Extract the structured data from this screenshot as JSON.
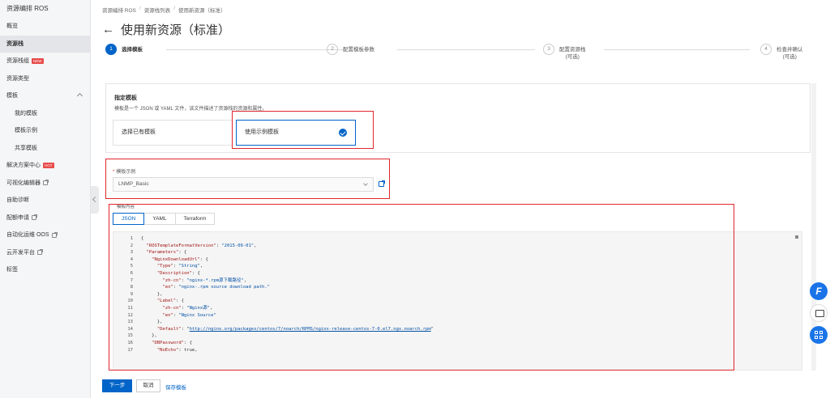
{
  "sidebar": {
    "title": "资源编排 ROS",
    "items": [
      {
        "label": "概览"
      },
      {
        "label": "资源栈",
        "active": true
      },
      {
        "label": "资源栈组",
        "badge": "NEW"
      },
      {
        "label": "资源类型"
      },
      {
        "label": "模板",
        "expandable": true
      },
      {
        "label": "我的模板",
        "sub": true
      },
      {
        "label": "模板示例",
        "sub": true
      },
      {
        "label": "共享模板",
        "sub": true
      },
      {
        "label": "解决方案中心",
        "badge": "HOT"
      },
      {
        "label": "可视化编辑器",
        "external": true
      },
      {
        "label": "自助诊断"
      },
      {
        "label": "配额申请",
        "external": true
      },
      {
        "label": "自动化运维 OOS",
        "external": true
      },
      {
        "label": "云开发平台",
        "external": true
      },
      {
        "label": "标签"
      }
    ]
  },
  "breadcrumb": [
    "资源编排 ROS",
    "资源栈列表",
    "使用新资源（标准）"
  ],
  "page_title": "使用新资源（标准）",
  "steps": [
    {
      "num": "1",
      "label": "选择模板",
      "active": true
    },
    {
      "num": "2",
      "label": "配置模板参数"
    },
    {
      "num": "3",
      "label": "配置资源栈",
      "sub": "(可选)"
    },
    {
      "num": "4",
      "label": "检查并确认",
      "sub": "(可选)"
    }
  ],
  "specify_template": {
    "title": "指定模板",
    "description": "模板是一个 JSON 或 YAML 文件，该文件描述了资源栈的资源和属性。",
    "options": [
      "选择已有模板",
      "使用示例模板"
    ],
    "selected": "使用示例模板"
  },
  "template_example": {
    "label": "模板示例",
    "value": "LNMP_Basic"
  },
  "template_content": {
    "label": "模板内容",
    "tabs": [
      "JSON",
      "YAML",
      "Terraform"
    ],
    "active_tab": "JSON"
  },
  "code_lines": [
    "{",
    "  \"ROSTemplateFormatVersion\": \"2015-09-01\",",
    "  \"Parameters\": {",
    "    \"NginxDownloadUrl\": {",
    "      \"Type\": \"String\",",
    "      \"Description\": {",
    "        \"zh-cn\": \"nginx-*.rpm源下载路径\",",
    "        \"en\": \"nginx-.rpm source download path.\"",
    "      },",
    "      \"Label\": {",
    "        \"zh-cn\": \"Nginx源\",",
    "        \"en\": \"Nginx Source\"",
    "      },",
    "      \"Default\": \"http://nginx.org/packages/centos/7/noarch/RPMS/nginx-release-centos-7-0.el7.ngx.noarch.rpm\"",
    "    },",
    "    \"DBPassword\": {",
    "      \"NoEcho\": true,"
  ],
  "buttons": {
    "next": "下一步",
    "cancel": "取消",
    "save": "保存模板"
  },
  "colors": {
    "primary": "#0064c8",
    "highlight": "#e0262b"
  }
}
